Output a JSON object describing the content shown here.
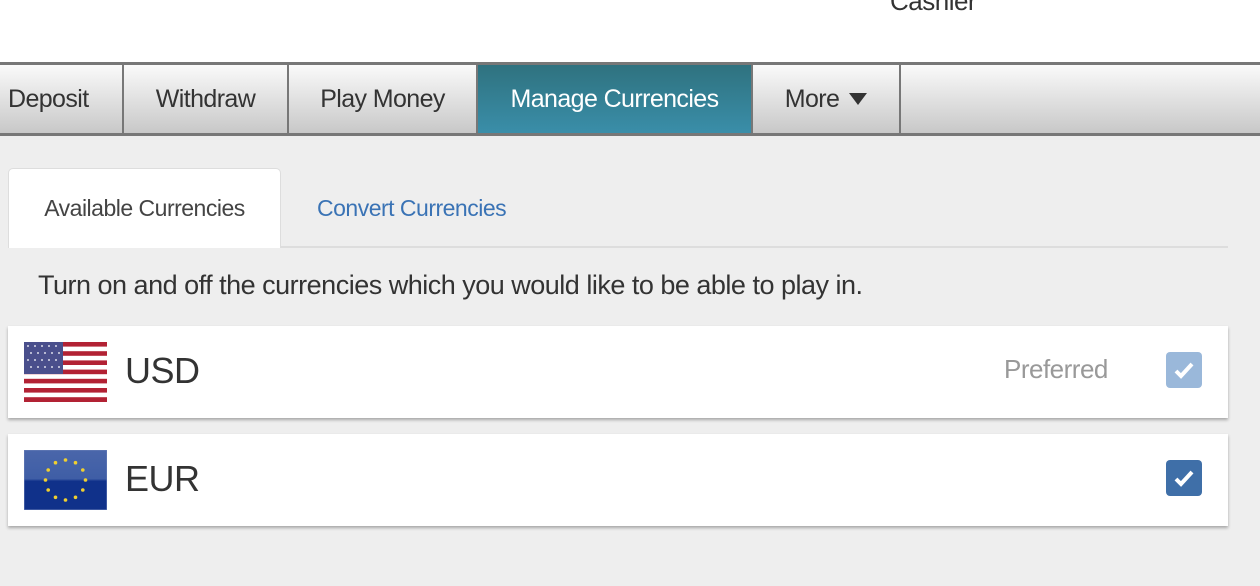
{
  "header": {
    "title": "Cashier"
  },
  "nav": {
    "items": [
      {
        "label": "Deposit"
      },
      {
        "label": "Withdraw"
      },
      {
        "label": "Play Money"
      },
      {
        "label": "Manage Currencies"
      },
      {
        "label": "More"
      }
    ]
  },
  "subtabs": {
    "available": "Available Currencies",
    "convert": "Convert Currencies"
  },
  "description": "Turn on and off the currencies which you would like to be able to play in.",
  "currencies": [
    {
      "code": "USD",
      "status": "Preferred",
      "checked": true,
      "disabled": true
    },
    {
      "code": "EUR",
      "status": "",
      "checked": true,
      "disabled": false
    }
  ],
  "colors": {
    "accent": "#3a8ea9",
    "link": "#3a73b5",
    "checkbox": "#3f6fa8",
    "checkbox_disabled": "#9ab8da"
  }
}
